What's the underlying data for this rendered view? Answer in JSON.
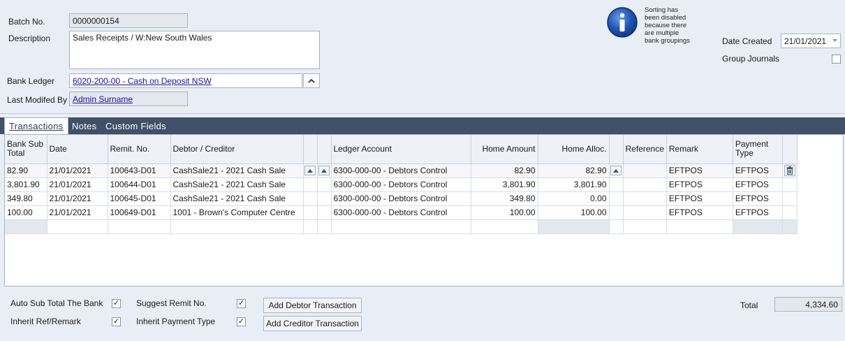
{
  "batch": {
    "label": "Batch No.",
    "value": "0000000154"
  },
  "description": {
    "label": "Description",
    "value": "Sales Receipts / W:New South Wales"
  },
  "bank_ledger": {
    "label": "Bank Ledger",
    "value": "6020-200-00 - Cash on Deposit NSW"
  },
  "last_modified": {
    "label": "Last Modifed By",
    "value": "Admin Surname"
  },
  "info": {
    "icon": "info-icon",
    "text": "Sorting has\nbeen disabled\nbecause there\nare multiple\nbank groupings"
  },
  "date_created": {
    "label": "Date Created",
    "value": "21/01/2021"
  },
  "group_journals": {
    "label": "Group Journals",
    "checked": false
  },
  "tabs": [
    {
      "label": "Transactions",
      "active": true
    },
    {
      "label": "Notes",
      "active": false
    },
    {
      "label": "Custom Fields",
      "active": false
    }
  ],
  "grid": {
    "headers": {
      "bank_sub_total": "Bank Sub\nTotal",
      "date": "Date",
      "remit": "Remit. No.",
      "debtor": "Debtor / Creditor",
      "ledger": "Ledger Account",
      "home_amount": "Home Amount",
      "home_alloc": "Home Alloc.",
      "reference": "Reference",
      "remark": "Remark",
      "payment_type": "Payment\nType"
    },
    "rows": [
      {
        "sub_total": "82.90",
        "date": "21/01/2021",
        "remit": "100643-D01",
        "debtor": "CashSale21 - 2021 Cash Sale",
        "ledger": "6300-000-00 - Debtors Control",
        "home_amount": "82.90",
        "home_alloc": "82.90",
        "reference": "",
        "remark": "EFTPOS",
        "payment_type": "EFTPOS"
      },
      {
        "sub_total": "3,801.90",
        "date": "21/01/2021",
        "remit": "100644-D01",
        "debtor": "CashSale21 - 2021 Cash Sale",
        "ledger": "6300-000-00 - Debtors Control",
        "home_amount": "3,801.90",
        "home_alloc": "3,801.90",
        "reference": "",
        "remark": "EFTPOS",
        "payment_type": "EFTPOS"
      },
      {
        "sub_total": "349.80",
        "date": "21/01/2021",
        "remit": "100645-D01",
        "debtor": "CashSale21 - 2021 Cash Sale",
        "ledger": "6300-000-00 - Debtors Control",
        "home_amount": "349.80",
        "home_alloc": "0.00",
        "reference": "",
        "remark": "EFTPOS",
        "payment_type": "EFTPOS"
      },
      {
        "sub_total": "100.00",
        "date": "21/01/2021",
        "remit": "100649-D01",
        "debtor": "1001 - Brown's Computer Centre",
        "ledger": "6300-000-00 - Debtors Control",
        "home_amount": "100.00",
        "home_alloc": "100.00",
        "reference": "",
        "remark": "EFTPOS",
        "payment_type": "EFTPOS"
      }
    ]
  },
  "options": {
    "auto_sub_total": {
      "label": "Auto Sub Total The Bank",
      "checked": true
    },
    "inherit_ref": {
      "label": "Inherit Ref/Remark",
      "checked": true
    },
    "suggest_remit": {
      "label": "Suggest Remit No.",
      "checked": true
    },
    "inherit_payment": {
      "label": "Inherit Payment Type",
      "checked": true
    }
  },
  "buttons": {
    "add_debtor": "Add Debtor Transaction",
    "add_creditor": "Add Creditor Transaction"
  },
  "total": {
    "label": "Total",
    "value": "4,334.60"
  },
  "colors": {
    "tabbar": "#3f5068",
    "link": "#1a0dab",
    "panel": "#e9edf5",
    "info_blue": "#1f56b8"
  }
}
